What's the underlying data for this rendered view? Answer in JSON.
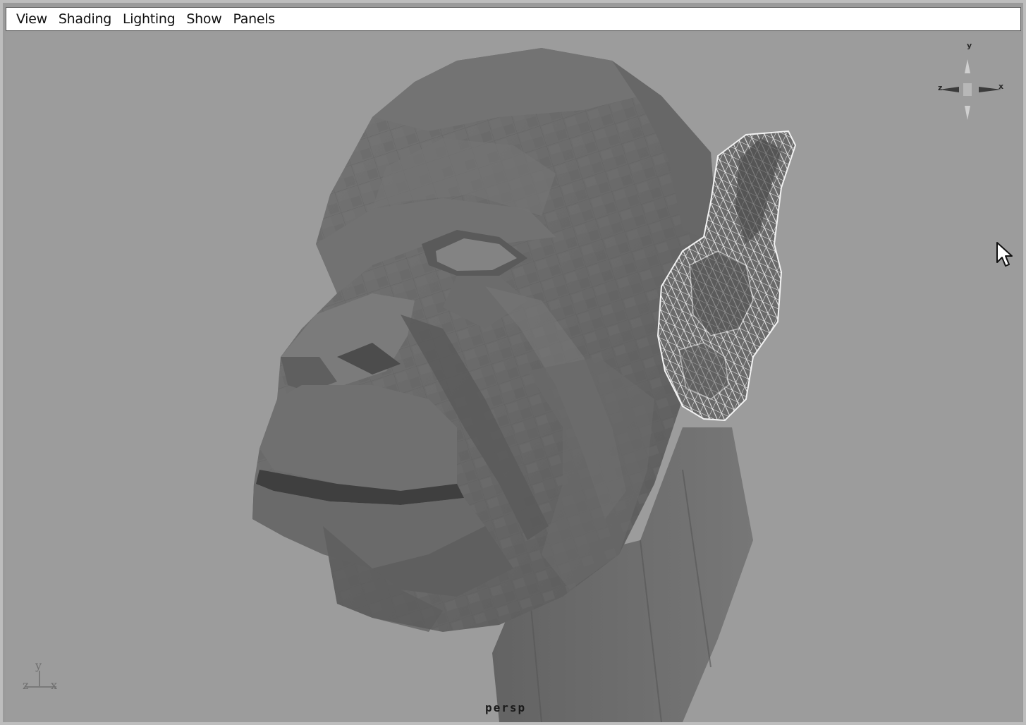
{
  "menubar": {
    "items": [
      {
        "label": "View"
      },
      {
        "label": "Shading"
      },
      {
        "label": "Lighting"
      },
      {
        "label": "Show"
      },
      {
        "label": "Panels"
      }
    ]
  },
  "viewport": {
    "camera_label": "persp",
    "background_color": "#9c9c9c",
    "mesh_color": "#6e6e6e",
    "wire_color": "#f2f2f2",
    "axis_indicator": {
      "y": "y",
      "z": "z",
      "x": "x"
    },
    "view_cube": {
      "y": "y",
      "x": "x",
      "z": "z"
    }
  }
}
